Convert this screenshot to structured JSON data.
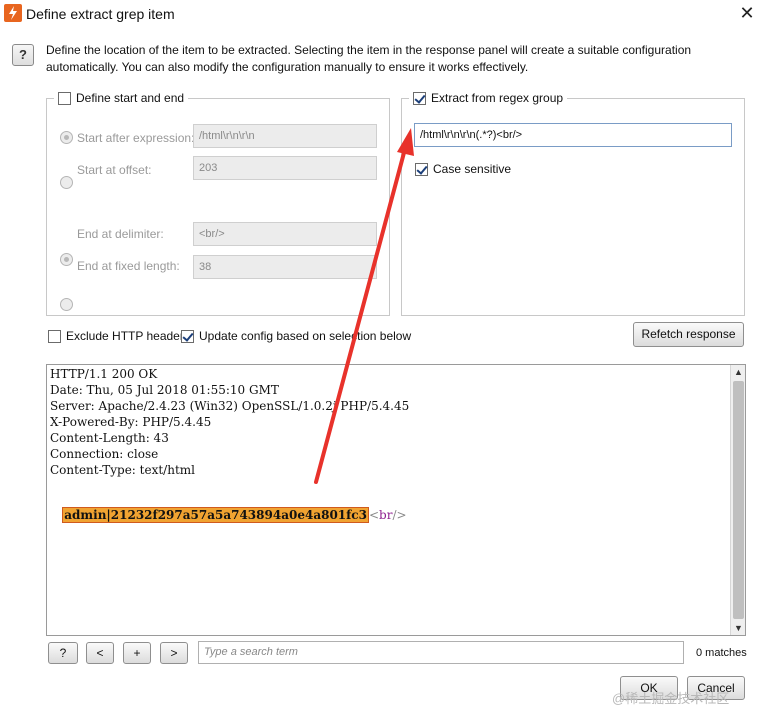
{
  "window": {
    "title": "Define extract grep item"
  },
  "help_label": "?",
  "description": "Define the location of the item to be extracted. Selecting the item in the response panel will create a suitable configuration automatically. You can also modify the configuration manually to ensure it works effectively.",
  "start_end": {
    "legend": "Define start and end",
    "start_after_label": "Start after expression:",
    "start_after_value": "/html\\r\\n\\r\\n",
    "start_offset_label": "Start at offset:",
    "start_offset_value": "203",
    "end_delim_label": "End at delimiter:",
    "end_delim_value": "<br/>",
    "end_fixed_label": "End at fixed length:",
    "end_fixed_value": "38"
  },
  "regex": {
    "legend": "Extract from regex group",
    "value": "/html\\r\\n\\r\\n(.*?)<br/>",
    "case_label": "Case sensitive"
  },
  "options": {
    "exclude_label": "Exclude HTTP headers",
    "update_label": "Update config based on selection below",
    "refetch_label": "Refetch response"
  },
  "response": {
    "lines": [
      "HTTP/1.1 200 OK",
      "Date: Thu, 05 Jul 2018 01:55:10 GMT",
      "Server: Apache/2.4.23 (Win32) OpenSSL/1.0.2j PHP/5.4.45",
      "X-Powered-By: PHP/5.4.45",
      "Content-Length: 43",
      "Connection: close",
      "Content-Type: text/html"
    ],
    "highlight": "admin|21232f297a57a5a743894a0e4a801fc3",
    "tag_lt": "<",
    "tag_name": "br",
    "tag_end": "/>"
  },
  "search": {
    "help": "?",
    "prev": "<",
    "add": "+",
    "next": ">",
    "placeholder": "Type a search term",
    "matches": "0 matches"
  },
  "buttons": {
    "ok": "OK",
    "cancel": "Cancel"
  },
  "watermark": "@稀土掘金技术社区",
  "colors": {
    "accent_arrow": "#e8322b",
    "highlight_bg": "#f0a331",
    "app_icon": "#e8651f"
  }
}
